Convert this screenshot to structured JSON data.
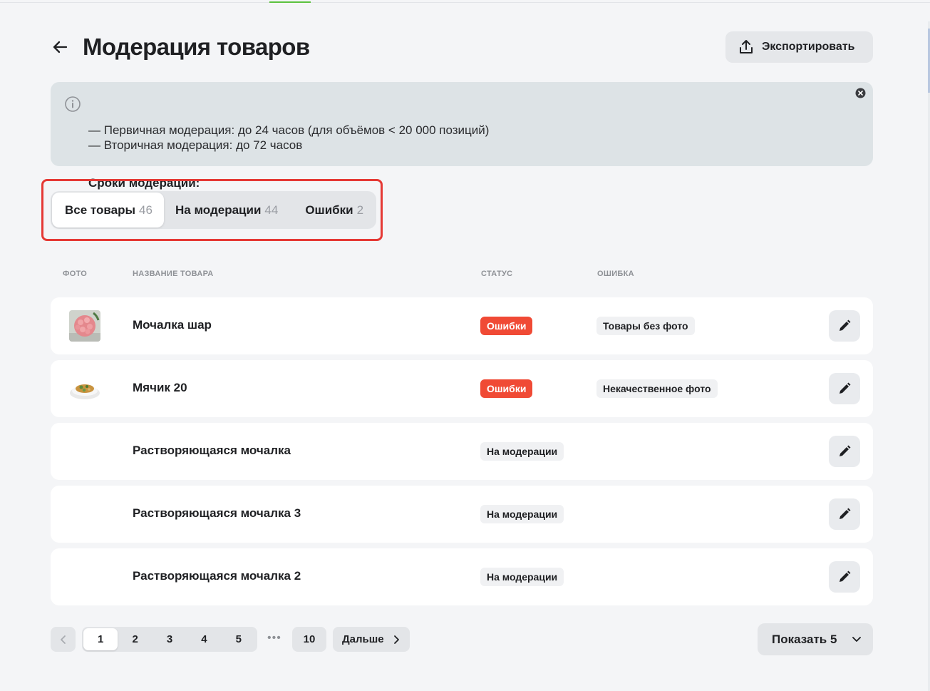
{
  "header": {
    "title": "Модерация товаров",
    "export_label": "Экспортировать"
  },
  "notice": {
    "title": "Сроки модерации:",
    "lines": [
      "— Первичная модерация: до 24 часов (для объёмов < 20 000 позиций)",
      "— Вторичная модерация: до 72 часов"
    ]
  },
  "tabs": [
    {
      "label": "Все товары",
      "count": "46",
      "active": true
    },
    {
      "label": "На модерации",
      "count": "44",
      "active": false
    },
    {
      "label": "Ошибки",
      "count": "2",
      "active": false
    }
  ],
  "table": {
    "columns": [
      "ФОТО",
      "НАЗВАНИЕ ТОВАРА",
      "СТАТУС",
      "ОШИБКА"
    ],
    "rows": [
      {
        "name": "Мочалка шар",
        "status": "Ошибки",
        "status_type": "error",
        "error": "Товары без фото",
        "photo": "pink-sponge"
      },
      {
        "name": "Мячик 20",
        "status": "Ошибки",
        "status_type": "error",
        "error": "Некачественное фото",
        "photo": "food-plate"
      },
      {
        "name": "Растворяющаяся мочалка",
        "status": "На модерации",
        "status_type": "moderation",
        "error": "",
        "photo": ""
      },
      {
        "name": "Растворяющаяся мочалка 3",
        "status": "На модерации",
        "status_type": "moderation",
        "error": "",
        "photo": ""
      },
      {
        "name": "Растворяющаяся мочалка 2",
        "status": "На модерации",
        "status_type": "moderation",
        "error": "",
        "photo": ""
      }
    ]
  },
  "pagination": {
    "pages": [
      "1",
      "2",
      "3",
      "4",
      "5"
    ],
    "current": "1",
    "ellipsis": "•••",
    "last": "10",
    "next_label": "Дальше"
  },
  "page_size": {
    "label": "Показать 5"
  },
  "colors": {
    "error_badge": "#f04a35",
    "highlight_outline": "#e53935",
    "accent_line": "#5bc23e"
  }
}
